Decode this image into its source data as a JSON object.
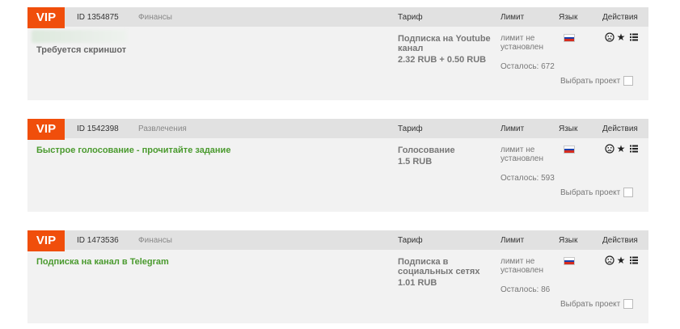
{
  "header_labels": {
    "tariff": "Тариф",
    "limit": "Лимит",
    "lang": "Язык",
    "actions": "Действия"
  },
  "colors": {
    "vip": "#f04e0b",
    "title_green": "#4a9a2e",
    "header_bg": "#e1e1e1",
    "card_bg": "#f2f2f2"
  },
  "projects": [
    {
      "badge": "VIP",
      "id": "ID 1354875",
      "category": "Финансы",
      "title": "Требуется скриншот",
      "tariff_name": "Подписка на Youtube канал",
      "price": "2.32 RUB + 0.50 RUB",
      "limit": "лимит не установлен",
      "remaining": "Осталось: 672",
      "language_icon": "russia-flag-icon",
      "select_label": "Выбрать проект"
    },
    {
      "badge": "VIP",
      "id": "ID 1542398",
      "category": "Развлечения",
      "title": "Быстрое голосование - прочитайте задание",
      "tariff_name": "Голосование",
      "price": "1.5 RUB",
      "limit": "лимит не установлен",
      "remaining": "Осталось: 593",
      "language_icon": "russia-flag-icon",
      "select_label": "Выбрать проект"
    },
    {
      "badge": "VIP",
      "id": "ID 1473536",
      "category": "Финансы",
      "title": "Подписка на канал в Telegram",
      "tariff_name": "Подписка в социальных сетях",
      "price": "1.01 RUB",
      "limit": "лимит не установлен",
      "remaining": "Осталось: 86",
      "language_icon": "russia-flag-icon",
      "select_label": "Выбрать проект"
    }
  ],
  "icons": [
    "sad-face-icon",
    "star-icon",
    "list-icon"
  ]
}
